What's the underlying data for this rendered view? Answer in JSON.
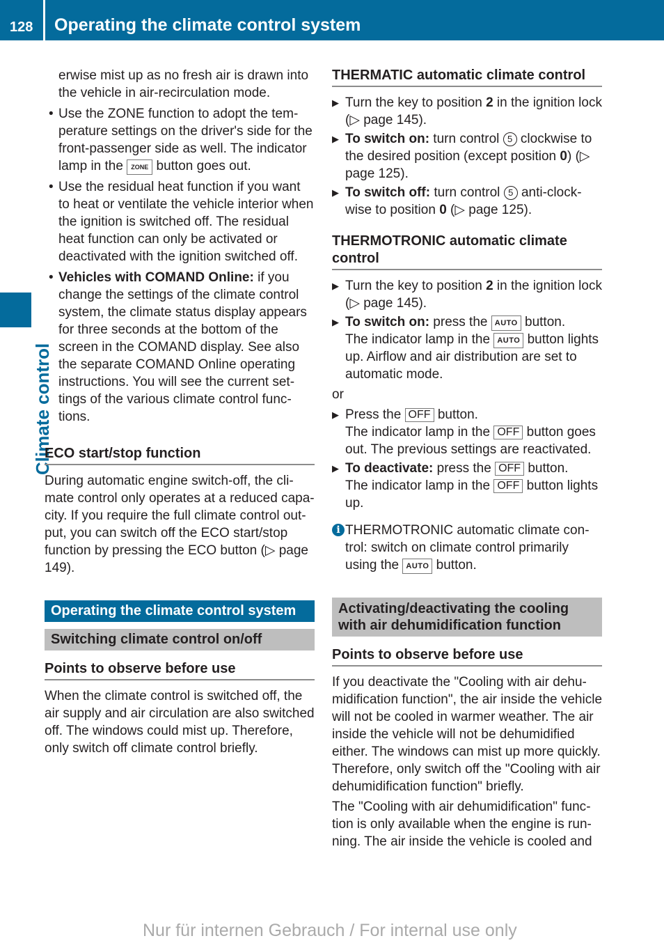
{
  "header": {
    "page_number": "128",
    "title": "Operating the climate control system"
  },
  "side_tab": {
    "label": "Climate control"
  },
  "left": {
    "intro_cont": "erwise mist up as no fresh air is drawn into the vehicle in air-recirculation mode.",
    "bullets": [
      {
        "pre": "Use the ZONE function to adopt the tem­perature settings on the driver's side for the front-passenger side as well. The indi­cator lamp in the ",
        "key": "ZONE",
        "post": " button goes out."
      },
      {
        "text": "Use the residual heat function if you want to heat or ventilate the vehicle interior when the ignition is switched off. The resid­ual heat function can only be activated or deactivated with the ignition switched off."
      },
      {
        "bold": "Vehicles with COMAND Online:",
        "text": " if you change the settings of the climate control system, the climate status display appears for three seconds at the bottom of the screen in the COMAND display. See also the separate COMAND Online operating instructions. You will see the current set­tings of the various climate control func­tions."
      }
    ],
    "eco_heading": "ECO start/stop function",
    "eco_text": "During automatic engine switch-off, the cli­mate control only operates at a reduced capa­city. If you require the full climate control out­put, you can switch off the ECO start/stop function by pressing the ECO button (▷ page 149).",
    "section_heading": "Operating the climate control system",
    "subsection_heading": "Switching climate control on/off",
    "points_heading": "Points to observe before use",
    "points_text": "When the climate control is switched off, the air supply and air circulation are also switched off. The windows could mist up. Therefore, only switch off climate control briefly."
  },
  "right": {
    "thermatic_heading": "THERMATIC automatic climate control",
    "thermatic_steps": [
      {
        "pre": "Turn the key to position ",
        "bold": "2",
        "post": " in the ignition lock (▷ page 145)."
      },
      {
        "label": "To switch on:",
        "pre": " turn control ",
        "circ": "5",
        "post": " clockwise to the desired position (except position ",
        "bold2": "0",
        "post2": ") (▷ page 125)."
      },
      {
        "label": "To switch off:",
        "pre": " turn control ",
        "circ": "5",
        "post": " anti-clock­wise to position ",
        "bold2": "0",
        "post2": " (▷ page 125)."
      }
    ],
    "thermotronic_heading": "THERMOTRONIC automatic climate control",
    "thermotronic_step1": {
      "pre": "Turn the key to position ",
      "bold": "2",
      "post": " in the ignition lock (▷ page 145)."
    },
    "switch_on": {
      "label": "To switch on:",
      "pre": " press the ",
      "key": "AUTO",
      "post": " button.",
      "line2_pre": "The indicator lamp in the ",
      "line2_post": " button lights up. Airflow and air distribution are set to automatic mode."
    },
    "or": "or",
    "press_off": {
      "pre": "Press the ",
      "key": "OFF",
      "post": " button.",
      "line2_pre": "The indicator lamp in the ",
      "line2_post": " button goes out. The previous settings are reactivated."
    },
    "deactivate": {
      "label": "To deactivate:",
      "pre": " press the ",
      "key": "OFF",
      "post": " button.",
      "line2_pre": "The indicator lamp in the ",
      "line2_post": " button lights up."
    },
    "info": {
      "pre": "THERMOTRONIC automatic climate con­trol: switch on climate control primarily using the ",
      "key": "AUTO",
      "post": " button."
    },
    "cooling_heading": "Activating/deactivating the cooling with air dehumidification function",
    "points_heading": "Points to observe before use",
    "points_text1": "If you deactivate the \"Cooling with air dehu­midification function\", the air inside the vehi­cle will not be cooled in warmer weather. The air inside the vehicle will not be dehumidified either. The windows can mist up more quickly. Therefore, only switch off the \"Cool­ing with air dehumidification function\" briefly.",
    "points_text2": "The \"Cooling with air dehumidification\" func­tion is only available when the engine is run­ning. The air inside the vehicle is cooled and"
  },
  "watermark": "Nur für internen Gebrauch / For internal use only",
  "colors": {
    "brand_blue": "#046b9c",
    "section_grey": "#bebebe"
  }
}
